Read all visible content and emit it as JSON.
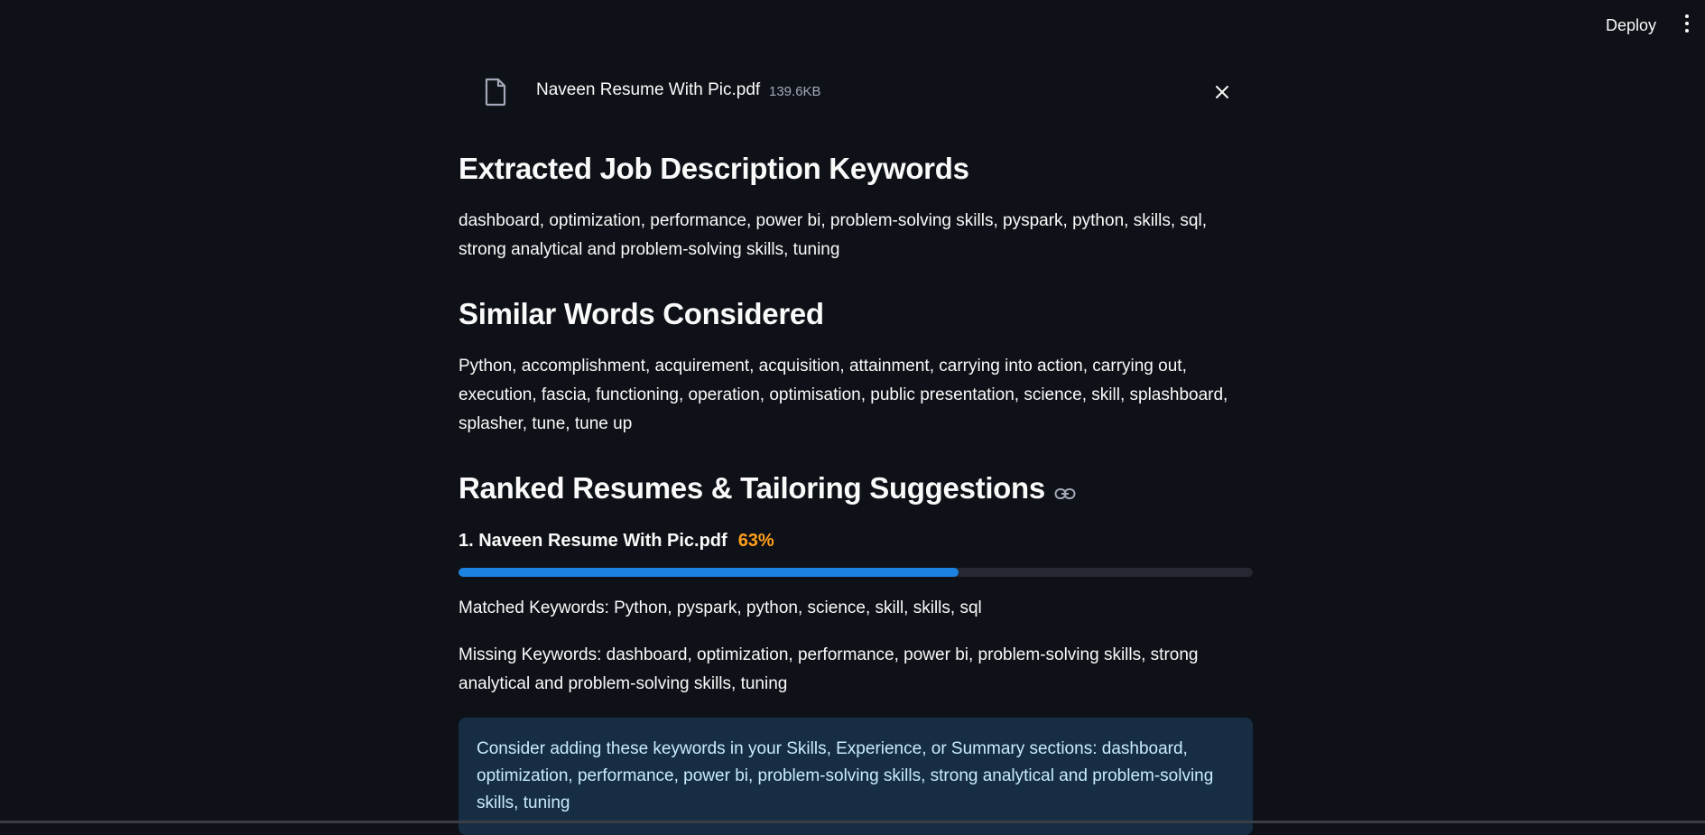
{
  "topbar": {
    "deploy_label": "Deploy",
    "menu_icon": "vertical-dots-icon"
  },
  "uploaded_file": {
    "name": "Naveen Resume With Pic.pdf",
    "size": "139.6KB",
    "icon": "file-icon",
    "close_icon": "close-icon"
  },
  "sections": {
    "keywords": {
      "heading": "Extracted Job Description Keywords",
      "text": "dashboard, optimization, performance, power bi, problem-solving skills, pyspark, python, skills, sql, strong analytical and problem-solving skills, tuning"
    },
    "similar": {
      "heading": "Similar Words Considered",
      "text": "Python, accomplishment, acquirement, acquisition, attainment, carrying into action, carrying out, execution, fascia, functioning, operation, optimisation, public presentation, science, skill, splashboard, splasher, tune, tune up"
    },
    "ranked": {
      "heading": "Ranked Resumes & Tailoring Suggestions",
      "link_icon": "link-icon"
    }
  },
  "ranking": {
    "rank_label": "1. Naveen Resume With Pic.pdf",
    "percent_label": "63%",
    "progress": 0.63,
    "matched": "Matched Keywords: Python, pyspark, python, science, skill, skills, sql",
    "missing": "Missing Keywords: dashboard, optimization, performance, power bi, problem-solving skills, strong analytical and problem-solving skills, tuning",
    "suggestion": "Consider adding these keywords in your Skills, Experience, or Summary sections: dashboard, optimization, performance, power bi, problem-solving skills, strong analytical and problem-solving skills, tuning"
  },
  "colors": {
    "background": "#0e1117",
    "progress_fill": "#1c83e1",
    "progress_track": "#262730",
    "percent": "#ff9f1a",
    "info_bg": "#172d43",
    "info_text": "#c7ebff"
  }
}
